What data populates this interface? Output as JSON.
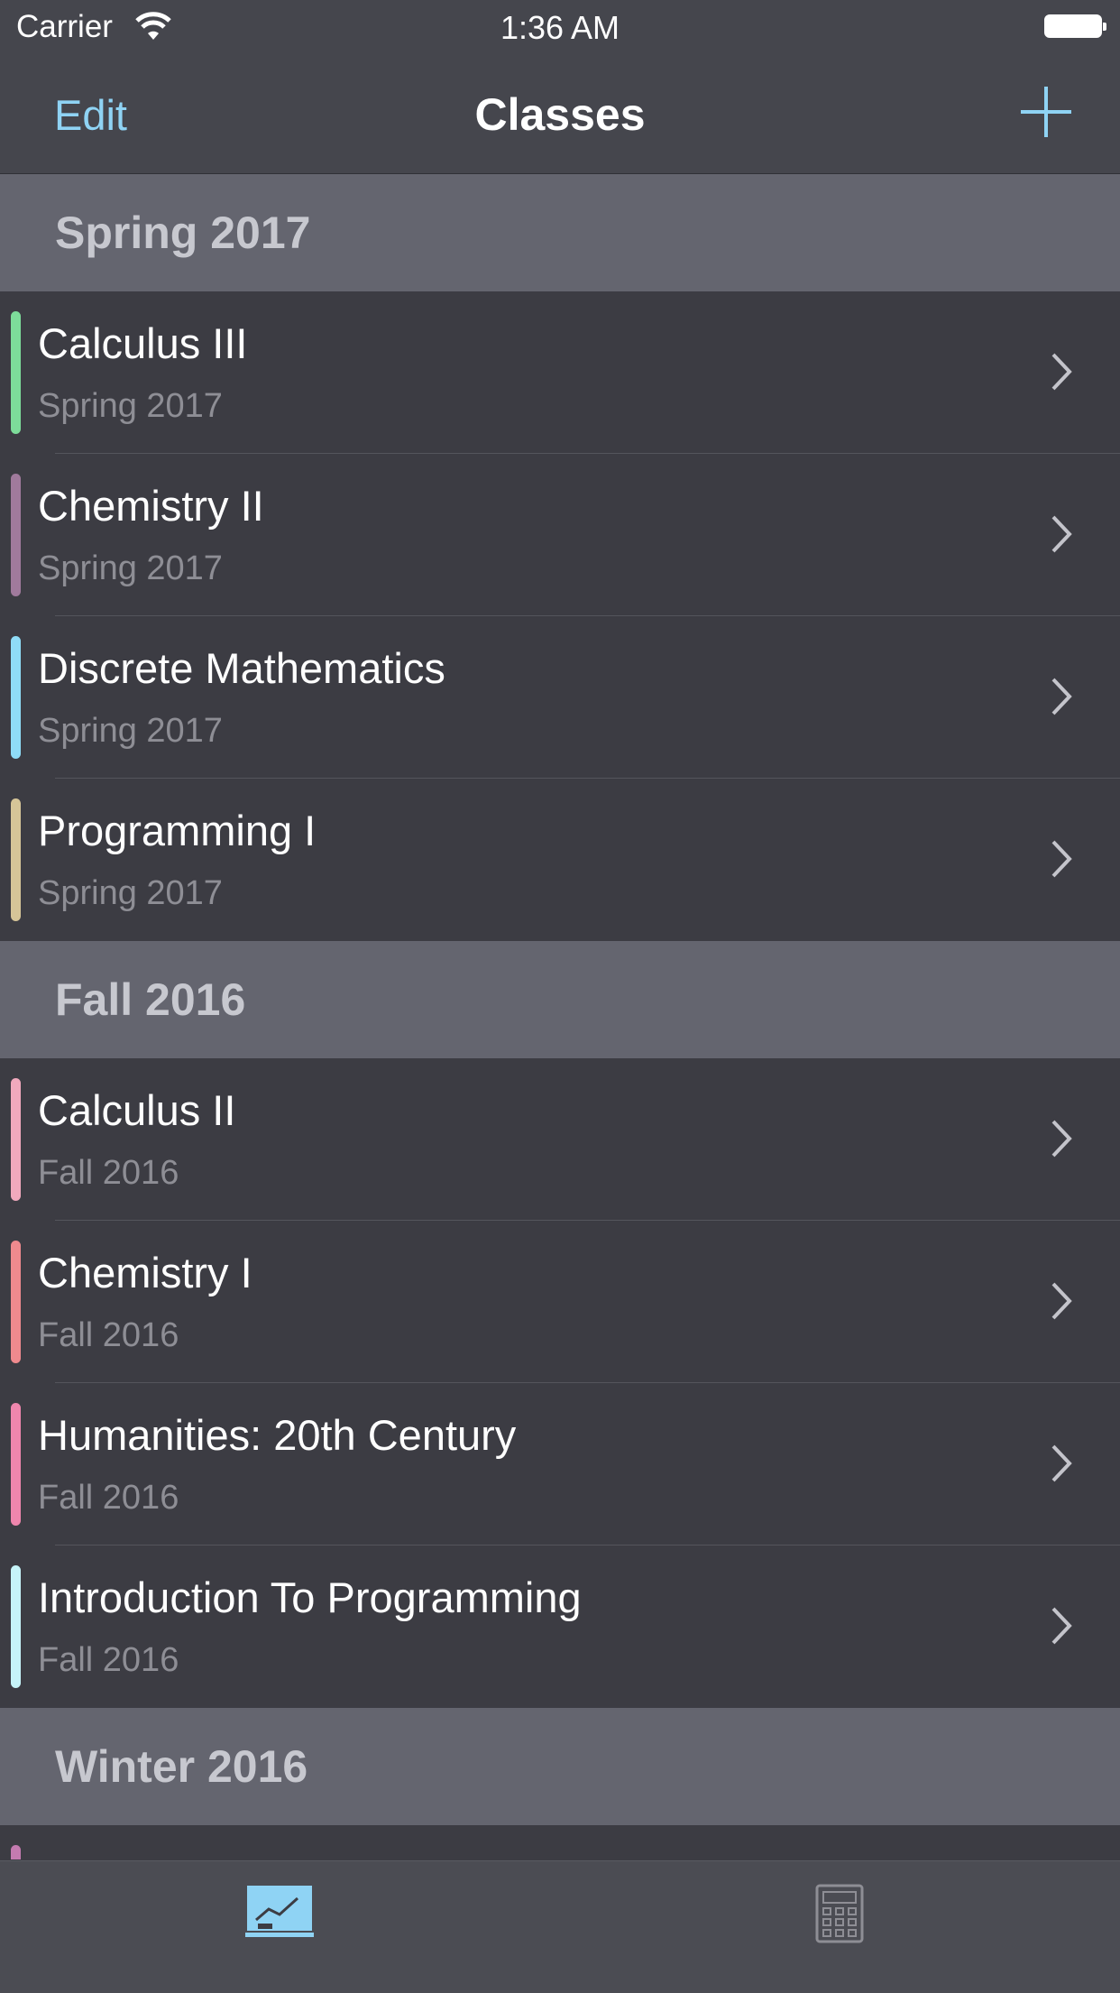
{
  "status_bar": {
    "carrier": "Carrier",
    "time": "1:36 AM",
    "wifi_icon": "wifi-icon",
    "battery_icon": "battery-full-icon"
  },
  "nav": {
    "edit_label": "Edit",
    "title": "Classes",
    "add_icon": "plus-icon"
  },
  "colors": {
    "accent": "#8fd3f4",
    "nav_background": "#45464d",
    "list_background": "#3c3c43",
    "section_background": "#64656f"
  },
  "sections": [
    {
      "title": "Spring 2017",
      "rows": [
        {
          "title": "Calculus III",
          "subtitle": "Spring 2017",
          "color": "#7ddc9a"
        },
        {
          "title": "Chemistry II",
          "subtitle": "Spring 2017",
          "color": "#a07a9c"
        },
        {
          "title": "Discrete Mathematics",
          "subtitle": "Spring 2017",
          "color": "#8fdcf7"
        },
        {
          "title": "Programming I",
          "subtitle": "Spring 2017",
          "color": "#d6c598"
        }
      ]
    },
    {
      "title": "Fall 2016",
      "rows": [
        {
          "title": "Calculus II",
          "subtitle": "Fall 2016",
          "color": "#f1a9bd"
        },
        {
          "title": "Chemistry I",
          "subtitle": "Fall 2016",
          "color": "#ef8a8e"
        },
        {
          "title": "Humanities: 20th Century",
          "subtitle": "Fall 2016",
          "color": "#ef86ad"
        },
        {
          "title": "Introduction To Programming",
          "subtitle": "Fall 2016",
          "color": "#c6f4f9"
        }
      ]
    },
    {
      "title": "Winter 2016",
      "rows": [
        {
          "color": "#c47bb0"
        }
      ]
    }
  ],
  "tab_bar": {
    "tabs": [
      {
        "icon": "chart-board-icon",
        "selected": true
      },
      {
        "icon": "calculator-icon",
        "selected": false
      }
    ]
  }
}
